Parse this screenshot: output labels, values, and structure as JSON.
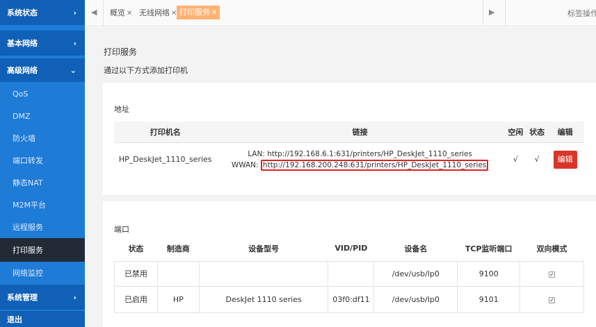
{
  "sidebar": {
    "items": [
      {
        "label": "系统状态",
        "chevron": "›"
      },
      {
        "label": "基本网络",
        "chevron": "›"
      },
      {
        "label": "高级网络",
        "chevron": "⌄"
      },
      {
        "label": "QoS"
      },
      {
        "label": "DMZ"
      },
      {
        "label": "防火墙"
      },
      {
        "label": "端口转发"
      },
      {
        "label": "静态NAT"
      },
      {
        "label": "M2M平台"
      },
      {
        "label": "远程服务"
      },
      {
        "label": "打印服务"
      },
      {
        "label": "网络监控"
      },
      {
        "label": "系统管理",
        "chevron": "›"
      },
      {
        "label": "退出"
      }
    ]
  },
  "tabbar": {
    "nav_left": "◀",
    "nav_right": "▶",
    "tabs": [
      {
        "label": "概览",
        "close": "✕"
      },
      {
        "label": "无线网络",
        "close": "✕"
      },
      {
        "label": "打印服务",
        "close": "✕"
      }
    ],
    "ops_label": "标签操作▾"
  },
  "page": {
    "title": "打印服务",
    "subtitle": "通过以下方式添加打印机"
  },
  "address": {
    "label": "地址",
    "headers": [
      "打印机名",
      "链接",
      "空闲",
      "状态",
      "编辑"
    ],
    "row": {
      "name": "HP_DeskJet_1110_series",
      "lan_prefix": "LAN: ",
      "lan_url": "http://192.168.6.1:631/printers/HP_DeskJet_1110_series",
      "wwan_prefix": "WWAN: ",
      "wwan_url": "http://192.168.200.248:631/printers/HP_DeskJet_1110_series",
      "idle": "√",
      "status": "√",
      "edit_label": "编辑"
    }
  },
  "port": {
    "label": "端口",
    "headers": [
      "状态",
      "制造商",
      "设备型号",
      "VID/PID",
      "设备名",
      "TCP监听端口",
      "双向模式"
    ],
    "rows": [
      {
        "status": "已禁用",
        "maker": "",
        "model": "",
        "vidpid": "",
        "device": "/dev/usb/lp0",
        "port": "9100",
        "bidir": "✓"
      },
      {
        "status": "已启用",
        "maker": "HP",
        "model": "DeskJet 1110 series",
        "vidpid": "03f0:df11",
        "device": "/dev/usb/lp0",
        "port": "9101",
        "bidir": "✓"
      }
    ]
  },
  "colors": {
    "sidebar_bg": "#1e7bd6",
    "sidebar_header_bg": "#0f60b6",
    "sidebar_active_bg": "#222a36",
    "active_tab": "#ffb273",
    "edit_button": "#d9362b",
    "highlight_box": "#e02020"
  }
}
